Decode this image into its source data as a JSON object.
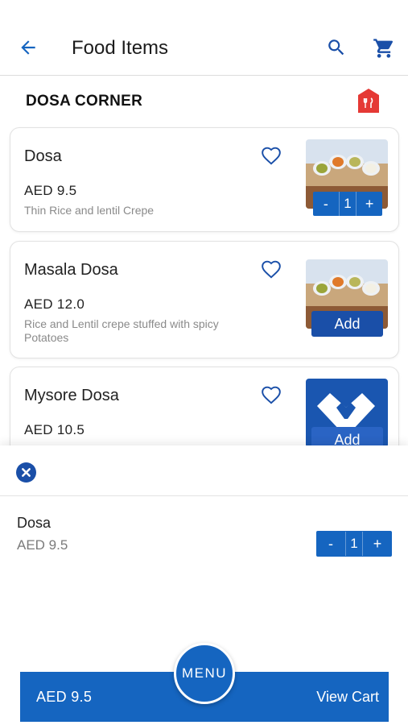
{
  "appbar": {
    "title": "Food Items",
    "back_icon": "arrow-left-icon",
    "search_icon": "search-icon",
    "cart_icon": "cart-icon"
  },
  "restaurant": {
    "name": "DOSA CORNER",
    "icon": "restaurant-icon"
  },
  "items": [
    {
      "name": "Dosa",
      "price": "AED  9.5",
      "description": "Thin Rice and lentil Crepe",
      "action": "stepper",
      "qty": "1",
      "minus": "-",
      "plus": "+"
    },
    {
      "name": "Masala Dosa",
      "price": "AED  12.0",
      "description": "Rice and Lentil crepe stuffed with spicy Potatoes",
      "action": "Add"
    },
    {
      "name": "Mysore Dosa",
      "price": "AED  10.5",
      "description": "",
      "action": "Add"
    }
  ],
  "sheet": {
    "item_name": "Dosa",
    "item_price": "AED 9.5",
    "qty": "1",
    "minus": "-",
    "plus": "+"
  },
  "bottom_bar": {
    "total": "AED  9.5",
    "menu_label": "MENU",
    "view_cart": "View Cart"
  },
  "colors": {
    "primary": "#1565c0",
    "dark_primary": "#1a4fa8",
    "restaurant_icon": "#e53935"
  }
}
